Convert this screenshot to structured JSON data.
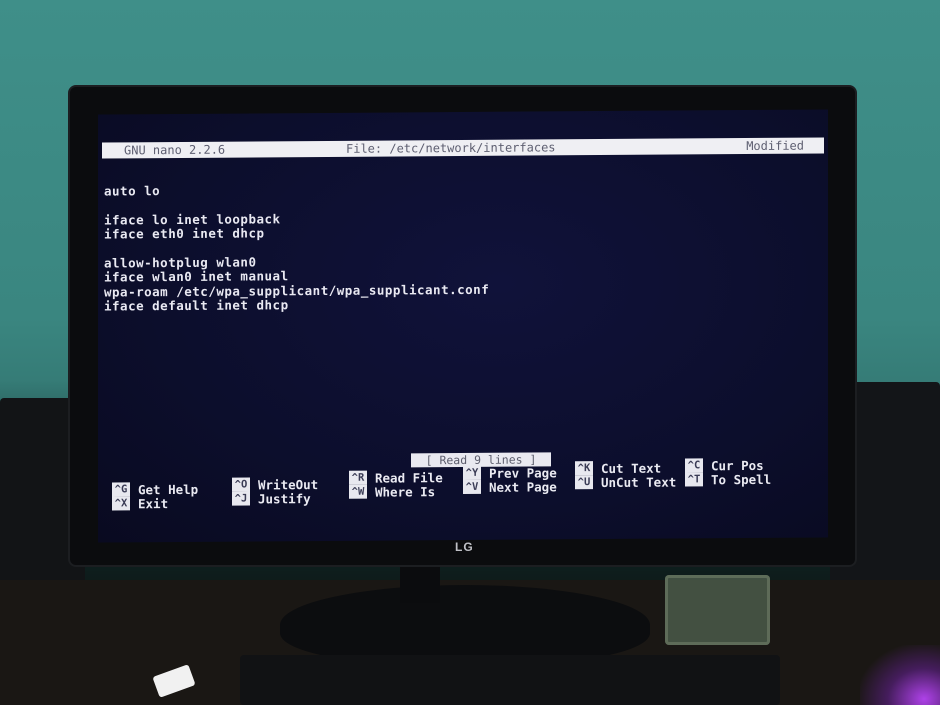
{
  "nano": {
    "title_left": "GNU nano 2.2.6",
    "title_file": "File: /etc/network/interfaces",
    "title_status": "Modified",
    "lines": [
      "auto lo",
      "",
      "iface lo inet loopback",
      "iface eth0 inet dhcp",
      "",
      "allow-hotplug wlan0",
      "iface wlan0 inet manual",
      "wpa-roam /etc/wpa_supplicant/wpa_supplicant.conf",
      "iface default inet dhcp"
    ],
    "status_message": "[ Read 9 lines ]",
    "shortcuts": [
      {
        "key": "^G",
        "label": "Get Help"
      },
      {
        "key": "^X",
        "label": "Exit"
      },
      {
        "key": "^O",
        "label": "WriteOut"
      },
      {
        "key": "^J",
        "label": "Justify"
      },
      {
        "key": "^R",
        "label": "Read File"
      },
      {
        "key": "^W",
        "label": "Where Is"
      },
      {
        "key": "^Y",
        "label": "Prev Page"
      },
      {
        "key": "^V",
        "label": "Next Page"
      },
      {
        "key": "^K",
        "label": "Cut Text"
      },
      {
        "key": "^U",
        "label": "UnCut Text"
      },
      {
        "key": "^C",
        "label": "Cur Pos"
      },
      {
        "key": "^T",
        "label": "To Spell"
      }
    ]
  },
  "monitor": {
    "brand_logo": "LG"
  }
}
